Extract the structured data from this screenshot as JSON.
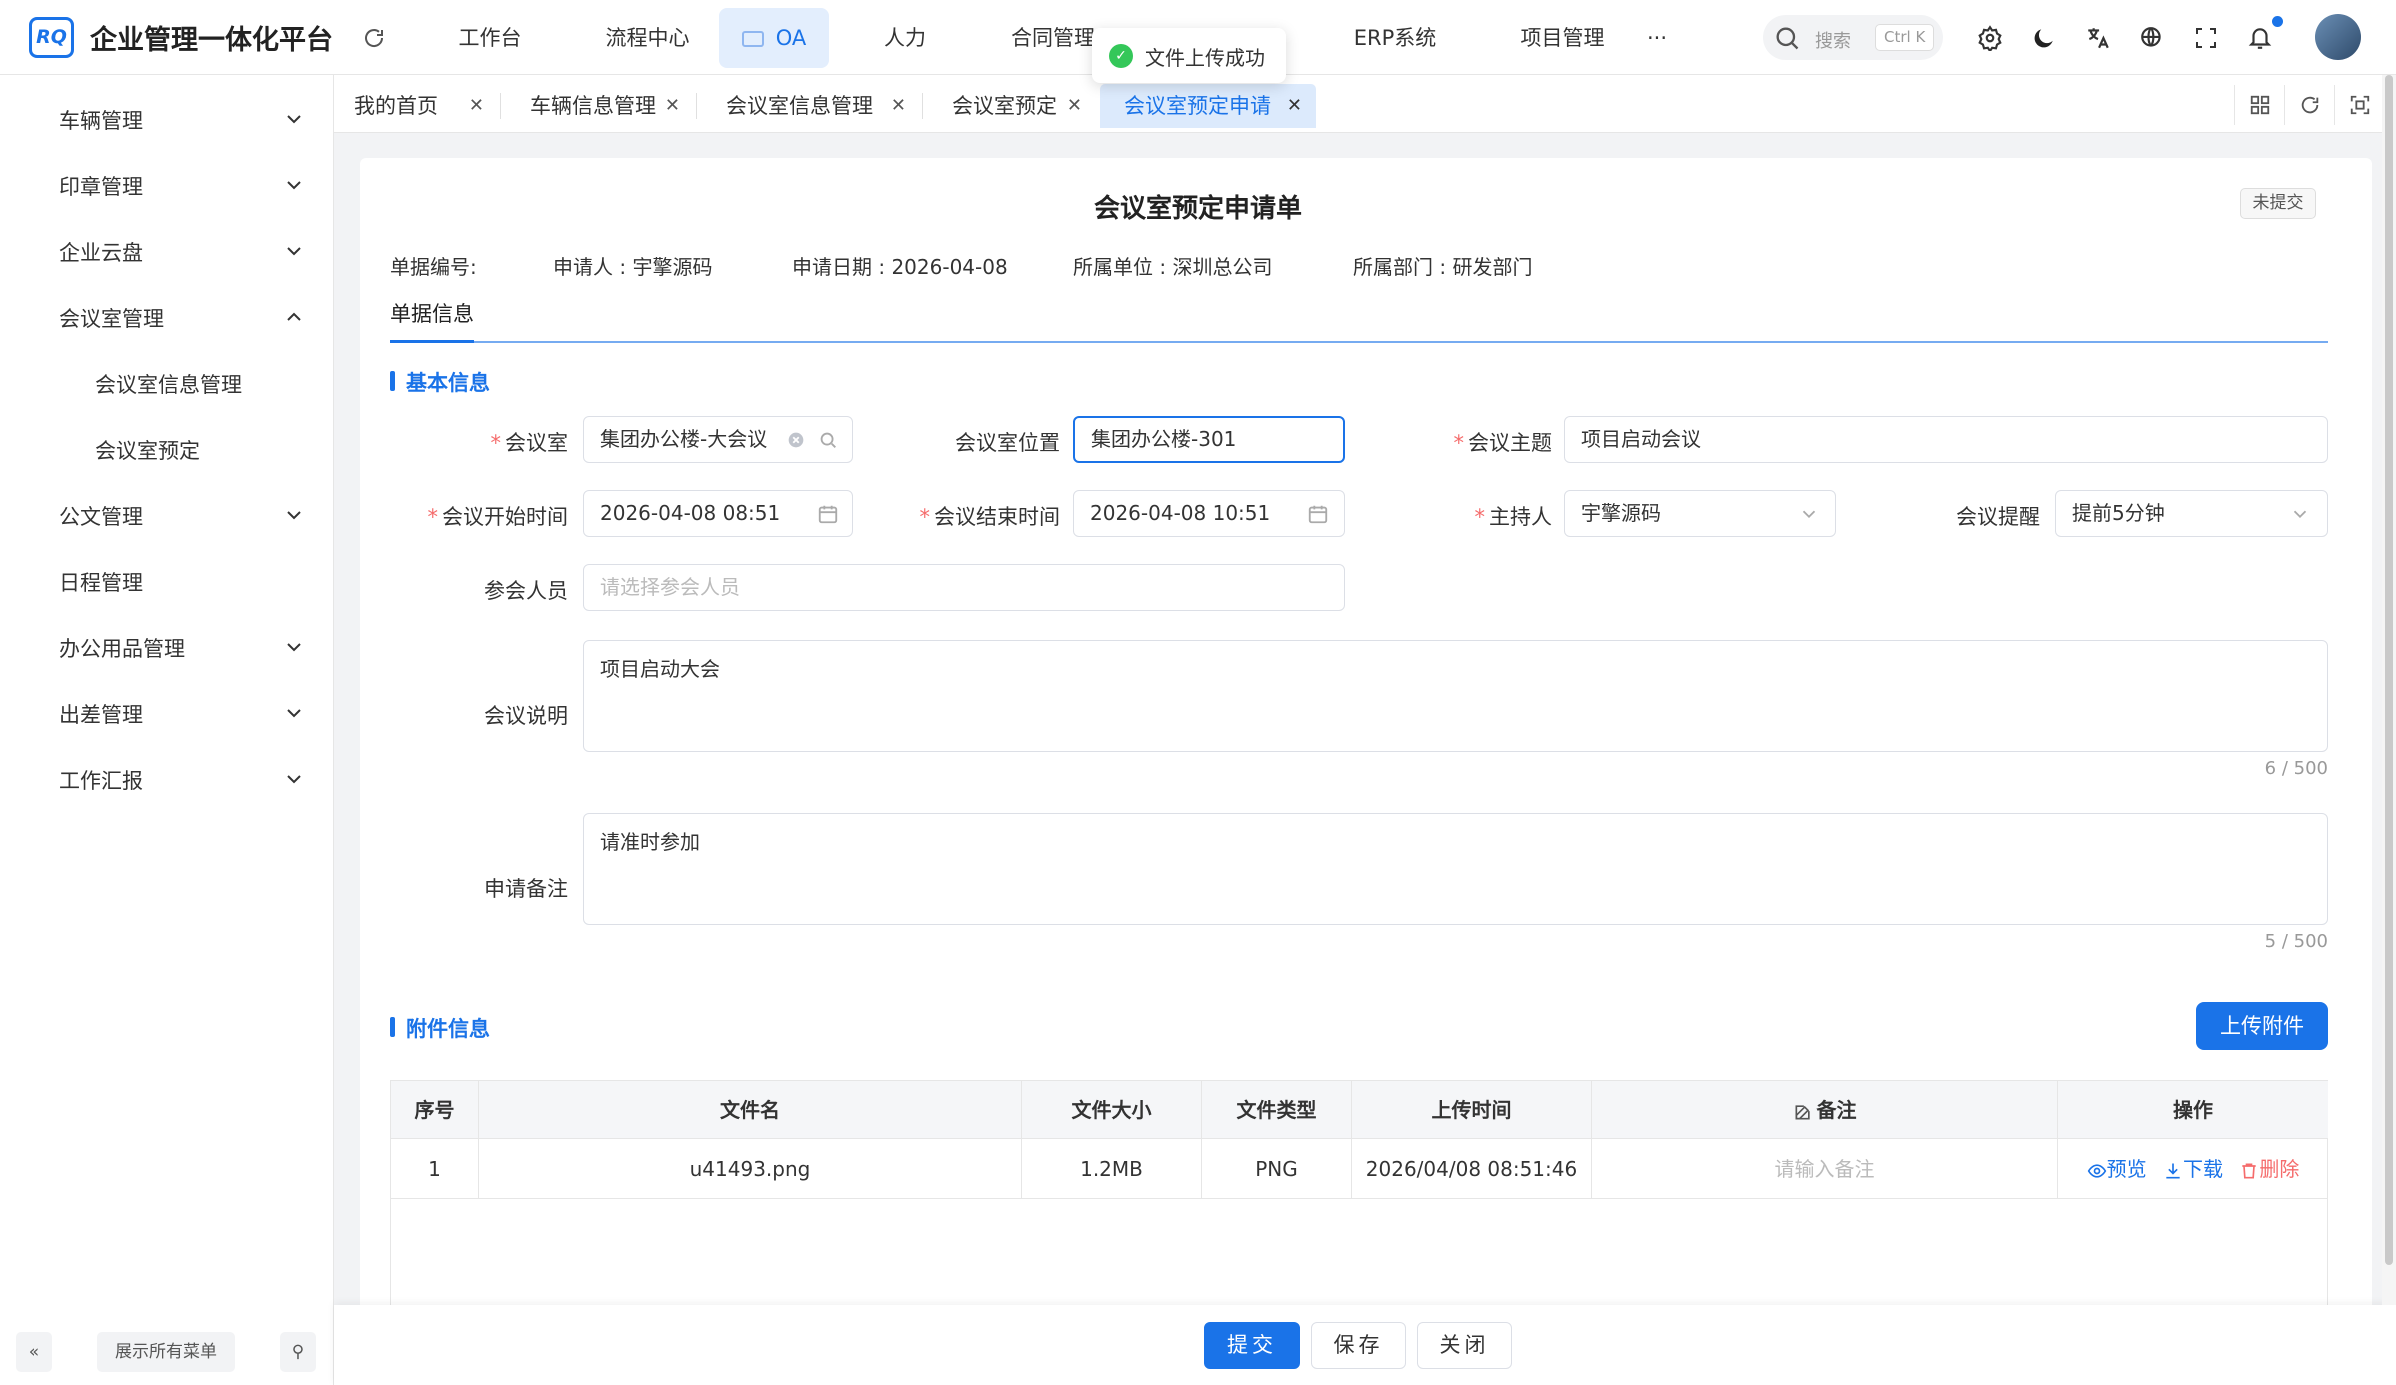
{
  "header": {
    "logo": "RQ",
    "app_title": "企业管理一体化平台",
    "nav": [
      {
        "label": "工作台"
      },
      {
        "label": "流程中心"
      },
      {
        "label": "OA"
      },
      {
        "label": "人力"
      },
      {
        "label": "合同管理"
      },
      {
        "label": "ERP系统"
      },
      {
        "label": "项目管理"
      },
      {
        "label": "···"
      }
    ],
    "search": {
      "placeholder": "搜索",
      "shortcut": "Ctrl K"
    }
  },
  "toast": {
    "message": "文件上传成功"
  },
  "sidebar": {
    "items": [
      {
        "label": "车辆管理"
      },
      {
        "label": "印章管理"
      },
      {
        "label": "企业云盘"
      },
      {
        "label": "会议室管理"
      },
      {
        "label": "会议室信息管理"
      },
      {
        "label": "会议室预定"
      },
      {
        "label": "公文管理"
      },
      {
        "label": "日程管理"
      },
      {
        "label": "办公用品管理"
      },
      {
        "label": "出差管理"
      },
      {
        "label": "工作汇报"
      }
    ],
    "footer": {
      "collapse": "«",
      "show_all": "展示所有菜单",
      "pin": "⚲"
    }
  },
  "tabs": [
    {
      "label": "我的首页"
    },
    {
      "label": "车辆信息管理"
    },
    {
      "label": "会议室信息管理"
    },
    {
      "label": "会议室预定"
    },
    {
      "label": "会议室预定申请"
    }
  ],
  "form": {
    "title": "会议室预定申请单",
    "status": "未提交",
    "meta": {
      "no": "单据编号:",
      "applicant": "申请人 : 宇擎源码",
      "date": "申请日期 : 2026-04-08",
      "unit": "所属单位 : 深圳总公司",
      "dept": "所属部门 : 研发部门"
    },
    "subtab": "单据信息",
    "section_basic": "基本信息",
    "fields": {
      "room": {
        "label": "会议室",
        "value": "集团办公楼-大会议"
      },
      "location": {
        "label": "会议室位置",
        "value": "集团办公楼-301"
      },
      "topic": {
        "label": "会议主题",
        "value": "项目启动会议"
      },
      "start": {
        "label": "会议开始时间",
        "value": "2026-04-08 08:51"
      },
      "end": {
        "label": "会议结束时间",
        "value": "2026-04-08 10:51"
      },
      "host": {
        "label": "主持人",
        "value": "宇擎源码"
      },
      "remind": {
        "label": "会议提醒",
        "value": "提前5分钟"
      },
      "attendees": {
        "label": "参会人员",
        "placeholder": "请选择参会人员"
      },
      "desc": {
        "label": "会议说明",
        "value": "项目启动大会",
        "count": "6 / 500"
      },
      "note": {
        "label": "申请备注",
        "value": "请准时参加",
        "count": "5 / 500"
      }
    },
    "section_attach": "附件信息",
    "upload": "上传附件",
    "table": {
      "headers": [
        "序号",
        "文件名",
        "文件大小",
        "文件类型",
        "上传时间",
        "备注",
        "操作"
      ],
      "rows": [
        {
          "no": "1",
          "name": "u41493.png",
          "size": "1.2MB",
          "type": "PNG",
          "time": "2026/04/08 08:51:46",
          "note_placeholder": "请输入备注",
          "preview": "预览",
          "download": "下载",
          "delete": "删除"
        }
      ]
    }
  },
  "actions": {
    "submit": "提交",
    "save": "保存",
    "close": "关闭"
  }
}
